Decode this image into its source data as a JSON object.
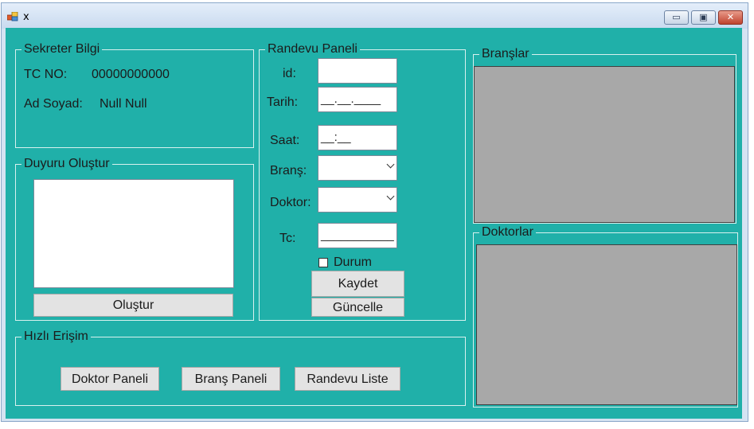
{
  "window": {
    "title": "x",
    "controls": {
      "minimize": "▭",
      "maximize": "▣",
      "close": "✕"
    }
  },
  "sekreter": {
    "legend": "Sekreter Bilgi",
    "tc_label": "TC NO:",
    "tc_value": "00000000000",
    "name_label": "Ad Soyad:",
    "name_value": "Null Null"
  },
  "duyuru": {
    "legend": "Duyuru Oluştur",
    "text": "",
    "button": "Oluştur"
  },
  "randevu": {
    "legend": "Randevu Paneli",
    "id_label": "id:",
    "id_value": "",
    "tarih_label": "Tarih:",
    "tarih_mask": "__.__.____",
    "saat_label": "Saat:",
    "saat_mask": "__:__",
    "brans_label": "Branş:",
    "brans_value": "",
    "doktor_label": "Doktor:",
    "doktor_value": "",
    "tc_label": "Tc:",
    "tc_mask": "___________",
    "durum_label": "Durum",
    "durum_checked": false,
    "save_button": "Kaydet",
    "update_button": "Güncelle"
  },
  "hizli": {
    "legend": "Hızlı Erişim",
    "buttons": [
      "Doktor Paneli",
      "Branş Paneli",
      "Randevu Liste"
    ]
  },
  "branslar": {
    "legend": "Branşlar"
  },
  "doktorlar": {
    "legend": "Doktorlar"
  },
  "colors": {
    "form_background": "#20b0a9",
    "grid_background": "#a8a8a8",
    "button_background": "#e3e3e3"
  }
}
